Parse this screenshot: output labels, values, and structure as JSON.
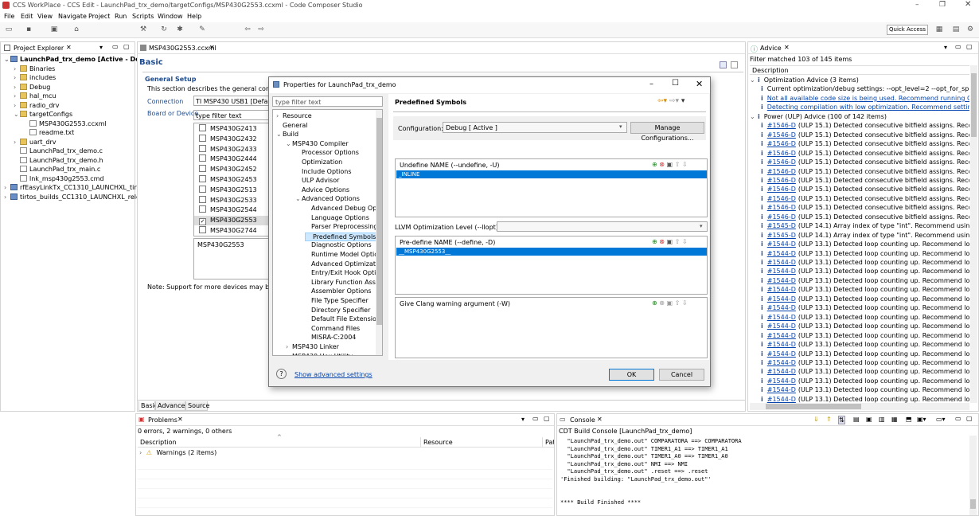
{
  "window": {
    "title": "CCS WorkPlace - CCS Edit - LaunchPad_trx_demo/targetConfigs/MSP430G2553.ccxml - Code Composer Studio"
  },
  "menu": [
    "File",
    "Edit",
    "View",
    "Navigate",
    "Project",
    "Run",
    "Scripts",
    "Window",
    "Help"
  ],
  "quick_access": "Quick Access",
  "project_explorer": {
    "tab": "Project Explorer",
    "items": [
      {
        "label": "LaunchPad_trx_demo  [Active - Debu",
        "indent": 0,
        "type": "proj",
        "open": true
      },
      {
        "label": "Binaries",
        "indent": 1,
        "type": "fold"
      },
      {
        "label": "includes",
        "indent": 1,
        "type": "fold"
      },
      {
        "label": "Debug",
        "indent": 1,
        "type": "fold"
      },
      {
        "label": "hal_mcu",
        "indent": 1,
        "type": "fold"
      },
      {
        "label": "radio_drv",
        "indent": 1,
        "type": "fold"
      },
      {
        "label": "targetConfigs",
        "indent": 1,
        "type": "fold",
        "open": true
      },
      {
        "label": "MSP430G2553.ccxml",
        "indent": 2,
        "type": "file"
      },
      {
        "label": "readme.txt",
        "indent": 2,
        "type": "file"
      },
      {
        "label": "uart_drv",
        "indent": 1,
        "type": "fold"
      },
      {
        "label": "LaunchPad_trx_demo.c",
        "indent": 1,
        "type": "file"
      },
      {
        "label": "LaunchPad_trx_demo.h",
        "indent": 1,
        "type": "file"
      },
      {
        "label": "LaunchPad_trx_main.c",
        "indent": 1,
        "type": "file"
      },
      {
        "label": "lnk_msp430g2553.cmd",
        "indent": 1,
        "type": "file"
      },
      {
        "label": "rfEasyLinkTx_CC1310_LAUNCHXL_tirtos",
        "indent": 0,
        "type": "proj"
      },
      {
        "label": "tirtos_builds_CC1310_LAUNCHXL_releas",
        "indent": 0,
        "type": "proj"
      }
    ]
  },
  "editor": {
    "tab": "MSP430G2553.ccxml",
    "heading": "Basic",
    "section": "General Setup",
    "desc": "This section describes the general configurati",
    "connection_label": "Connection",
    "connection_value": "TI MSP430 USB1 [Default]",
    "board_label": "Board or Device",
    "filter": "type filter text",
    "devices": [
      {
        "name": "MSP430G2413",
        "checked": false
      },
      {
        "name": "MSP430G2432",
        "checked": false
      },
      {
        "name": "MSP430G2433",
        "checked": false
      },
      {
        "name": "MSP430G2444",
        "checked": false
      },
      {
        "name": "MSP430G2452",
        "checked": false
      },
      {
        "name": "MSP430G2453",
        "checked": false
      },
      {
        "name": "MSP430G2513",
        "checked": false
      },
      {
        "name": "MSP430G2533",
        "checked": false
      },
      {
        "name": "MSP430G2544",
        "checked": false
      },
      {
        "name": "MSP430G2553",
        "checked": true
      },
      {
        "name": "MSP430G2744",
        "checked": false
      }
    ],
    "selected_device": "MSP430G2553",
    "note": "Note: Support for more devices may be ava",
    "bottom_tabs": [
      "Basic",
      "Advanced",
      "Source"
    ]
  },
  "dialog": {
    "title": "Properties for LaunchPad_trx_demo",
    "filter": "type filter text",
    "tree": [
      {
        "label": "Resource",
        "indent": 0,
        "arrow": ">"
      },
      {
        "label": "General",
        "indent": 0,
        "arrow": ""
      },
      {
        "label": "Build",
        "indent": 0,
        "arrow": "v"
      },
      {
        "label": "MSP430 Compiler",
        "indent": 1,
        "arrow": "v"
      },
      {
        "label": "Processor Options",
        "indent": 2,
        "arrow": ""
      },
      {
        "label": "Optimization",
        "indent": 2,
        "arrow": ""
      },
      {
        "label": "Include Options",
        "indent": 2,
        "arrow": ""
      },
      {
        "label": "ULP Advisor",
        "indent": 2,
        "arrow": ""
      },
      {
        "label": "Advice Options",
        "indent": 2,
        "arrow": ""
      },
      {
        "label": "Advanced Options",
        "indent": 2,
        "arrow": "v"
      },
      {
        "label": "Advanced Debug Opt",
        "indent": 3,
        "arrow": ""
      },
      {
        "label": "Language Options",
        "indent": 3,
        "arrow": ""
      },
      {
        "label": "Parser Preprocessing C",
        "indent": 3,
        "arrow": ""
      },
      {
        "label": "Predefined Symbols",
        "indent": 3,
        "arrow": "",
        "selected": true
      },
      {
        "label": "Diagnostic Options",
        "indent": 3,
        "arrow": ""
      },
      {
        "label": "Runtime Model Optio",
        "indent": 3,
        "arrow": ""
      },
      {
        "label": "Advanced Optimizatio",
        "indent": 3,
        "arrow": ""
      },
      {
        "label": "Entry/Exit Hook Optio",
        "indent": 3,
        "arrow": ""
      },
      {
        "label": "Library Function Assu",
        "indent": 3,
        "arrow": ""
      },
      {
        "label": "Assembler Options",
        "indent": 3,
        "arrow": ""
      },
      {
        "label": "File Type Specifier",
        "indent": 3,
        "arrow": ""
      },
      {
        "label": "Directory Specifier",
        "indent": 3,
        "arrow": ""
      },
      {
        "label": "Default File Extension",
        "indent": 3,
        "arrow": ""
      },
      {
        "label": "Command Files",
        "indent": 3,
        "arrow": ""
      },
      {
        "label": "MISRA-C:2004",
        "indent": 3,
        "arrow": ""
      },
      {
        "label": "MSP430 Linker",
        "indent": 1,
        "arrow": ">"
      },
      {
        "label": "MSP430 Hex Utility",
        "indent": 1,
        "arrow": ">"
      }
    ],
    "page_title": "Predefined Symbols",
    "config_label": "Configuration:",
    "config_value": "Debug  [ Active ]",
    "manage_btn": "Manage Configurations...",
    "undefine_label": "Undefine NAME (--undefine, -U)",
    "undefine_item": "_INLINE",
    "llvm_label": "LLVM Optimization Level (--llopt)",
    "predefine_label": "Pre-define NAME (--define, -D)",
    "predefine_item": "__MSP430G2553__",
    "clang_label": "Give Clang warning argument (-W)",
    "adv_link": "Show advanced settings",
    "ok": "OK",
    "cancel": "Cancel"
  },
  "advice": {
    "tab": "Advice",
    "filter_text": "Filter matched 103 of 145 items",
    "col": "Description",
    "opt_group": "Optimization Advice (3 items)",
    "opt_items": [
      {
        "text": "Current optimization/debug settings:  --opt_level=2  --opt_for_speed",
        "link": false
      },
      {
        "text": "Not all available code size is being used. Recommend running Optim",
        "link": true
      },
      {
        "text": "Detecting compilation with low optimization. Recommend setting --",
        "link": true
      }
    ],
    "ulp_group": "Power (ULP) Advice (100 of 142 items)",
    "ulp_items": [
      {
        "code": "#1546-D",
        "text": "(ULP 15.1) Detected consecutive bitfield assigns. Recomm"
      },
      {
        "code": "#1546-D",
        "text": "(ULP 15.1) Detected consecutive bitfield assigns. Recomm"
      },
      {
        "code": "#1546-D",
        "text": "(ULP 15.1) Detected consecutive bitfield assigns. Recomm"
      },
      {
        "code": "#1546-D",
        "text": "(ULP 15.1) Detected consecutive bitfield assigns. Recomm"
      },
      {
        "code": "#1546-D",
        "text": "(ULP 15.1) Detected consecutive bitfield assigns. Recomm"
      },
      {
        "code": "#1546-D",
        "text": "(ULP 15.1) Detected consecutive bitfield assigns. Recomm"
      },
      {
        "code": "#1546-D",
        "text": "(ULP 15.1) Detected consecutive bitfield assigns. Recomm"
      },
      {
        "code": "#1546-D",
        "text": "(ULP 15.1) Detected consecutive bitfield assigns. Recomm"
      },
      {
        "code": "#1546-D",
        "text": "(ULP 15.1) Detected consecutive bitfield assigns. Recomm"
      },
      {
        "code": "#1546-D",
        "text": "(ULP 15.1) Detected consecutive bitfield assigns. Recomm"
      },
      {
        "code": "#1546-D",
        "text": "(ULP 15.1) Detected consecutive bitfield assigns. Recomm"
      },
      {
        "code": "#1545-D",
        "text": "(ULP 14.1) Array index of type \"int\". Recommend using \"u"
      },
      {
        "code": "#1545-D",
        "text": "(ULP 14.1) Array index of type \"int\". Recommend using \"u"
      },
      {
        "code": "#1544-D",
        "text": "(ULP 13.1) Detected loop counting up. Recommend loop"
      },
      {
        "code": "#1544-D",
        "text": "(ULP 13.1) Detected loop counting up. Recommend loop"
      },
      {
        "code": "#1544-D",
        "text": "(ULP 13.1) Detected loop counting up. Recommend loop"
      },
      {
        "code": "#1544-D",
        "text": "(ULP 13.1) Detected loop counting up. Recommend loop"
      },
      {
        "code": "#1544-D",
        "text": "(ULP 13.1) Detected loop counting up. Recommend loop"
      },
      {
        "code": "#1544-D",
        "text": "(ULP 13.1) Detected loop counting up. Recommend loop"
      },
      {
        "code": "#1544-D",
        "text": "(ULP 13.1) Detected loop counting up. Recommend loop"
      },
      {
        "code": "#1544-D",
        "text": "(ULP 13.1) Detected loop counting up. Recommend loop"
      },
      {
        "code": "#1544-D",
        "text": "(ULP 13.1) Detected loop counting up. Recommend loop"
      },
      {
        "code": "#1544-D",
        "text": "(ULP 13.1) Detected loop counting up. Recommend loop"
      },
      {
        "code": "#1544-D",
        "text": "(ULP 13.1) Detected loop counting up. Recommend loop"
      },
      {
        "code": "#1544-D",
        "text": "(ULP 13.1) Detected loop counting up. Recommend loop"
      },
      {
        "code": "#1544-D",
        "text": "(ULP 13.1) Detected loop counting up. Recommend loop"
      },
      {
        "code": "#1544-D",
        "text": "(ULP 13.1) Detected loop counting up. Recommend loop"
      },
      {
        "code": "#1544-D",
        "text": "(ULP 13.1) Detected loop counting up. Recommend loop"
      },
      {
        "code": "#1544-D",
        "text": "(ULP 13.1) Detected loop counting up. Recommend loop"
      },
      {
        "code": "#1544-D",
        "text": "(ULP 13.1) Detected loop counting up. Recommend loop"
      },
      {
        "code": "#1544-D",
        "text": "(ULP 13.1) Detected loop counting up. Recommend loop"
      }
    ]
  },
  "problems": {
    "tab": "Problems",
    "summary": "0 errors, 2 warnings, 0 others",
    "cols": [
      "Description",
      "Resource",
      "Pat"
    ],
    "row": "Warnings (2 items)"
  },
  "console": {
    "tab": "Console",
    "title": "CDT Build Console [LaunchPad_trx_demo]",
    "lines": [
      "  \"LaunchPad_trx_demo.out\" COMPARATORA ==> COMPARATORA",
      "  \"LaunchPad_trx_demo.out\" TIMER1_A1 ==> TIMER1_A1",
      "  \"LaunchPad_trx_demo.out\" TIMER1_A0 ==> TIMER1_A0",
      "  \"LaunchPad_trx_demo.out\" NMI ==> NMI",
      "  \"LaunchPad_trx_demo.out\" .reset ==> .reset",
      "'Finished building: \"LaunchPad_trx_demo.out\"'",
      "",
      "",
      "**** Build Finished ****"
    ]
  }
}
